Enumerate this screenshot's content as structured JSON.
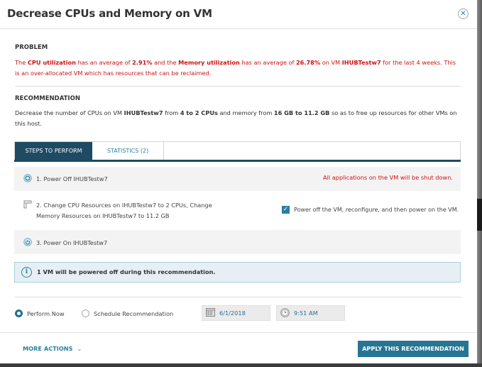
{
  "dialog": {
    "title": "Decrease CPUs and Memory on VM",
    "close_icon": "close-circle-icon"
  },
  "problem": {
    "heading": "PROBLEM",
    "text_parts": [
      {
        "text": "The ",
        "bold": false
      },
      {
        "text": "CPU utilization",
        "bold": true
      },
      {
        "text": " has an average of ",
        "bold": false
      },
      {
        "text": "2.91%",
        "bold": true
      },
      {
        "text": " and the ",
        "bold": false
      },
      {
        "text": "Memory utilization",
        "bold": true
      },
      {
        "text": " has an average of ",
        "bold": false
      },
      {
        "text": "26.78%",
        "bold": true
      },
      {
        "text": " on VM ",
        "bold": false
      },
      {
        "text": "IHUBTestw7",
        "bold": true
      },
      {
        "text": " for the last 4 weeks. This is an over-allocated VM which has resources that can be reclaimed.",
        "bold": false
      }
    ],
    "color": "#cc1313"
  },
  "recommendation": {
    "heading": "RECOMMENDATION",
    "text_parts": [
      {
        "text": "Decrease the number of CPUs on VM ",
        "bold": false
      },
      {
        "text": "IHUBTestw7",
        "bold": true
      },
      {
        "text": " from ",
        "bold": false
      },
      {
        "text": "4 to 2 CPUs",
        "bold": true
      },
      {
        "text": " and memory from ",
        "bold": false
      },
      {
        "text": "16 GB to 11.2 GB",
        "bold": true
      },
      {
        "text": " so as to free up resources for other VMs on this host.",
        "bold": false
      }
    ]
  },
  "tabs": [
    {
      "label": "STEPS TO PERFORM",
      "active": true
    },
    {
      "label": "STATISTICS (2)",
      "active": false
    }
  ],
  "steps": [
    {
      "label": "1. Power Off IHUBTestw7",
      "icon": "power-off-icon",
      "note": "All applications on the VM will be shut down."
    },
    {
      "label_line1": "2. Change CPU Resources on IHUBTestw7 to 2 CPUs, Change",
      "label_line2": "Memory Resources on IHUBTestw7 to 11.2 GB",
      "icon": "resources-icon",
      "checkbox_checked": true,
      "checkbox_label": "Power off the VM, reconfigure, and then power on the VM."
    },
    {
      "label": "3. Power On IHUBTestw7",
      "icon": "power-on-icon"
    }
  ],
  "info": {
    "icon": "info-icon",
    "text": "1 VM will be powered off during this recommendation."
  },
  "schedule": {
    "options": [
      {
        "label": "Perform Now",
        "selected": true
      },
      {
        "label": "Schedule Recommendation",
        "selected": false
      }
    ],
    "date": "6/1/2018",
    "time": "9:51 AM",
    "date_icon": "calendar-icon",
    "time_icon": "clock-icon"
  },
  "footer": {
    "more_actions": "MORE ACTIONS",
    "chevron": "⌵",
    "apply": "APPLY THIS RECOMMENDATION"
  },
  "colors": {
    "accent": "#267592",
    "tab_active": "#1f4a63",
    "danger": "#cc1313"
  }
}
